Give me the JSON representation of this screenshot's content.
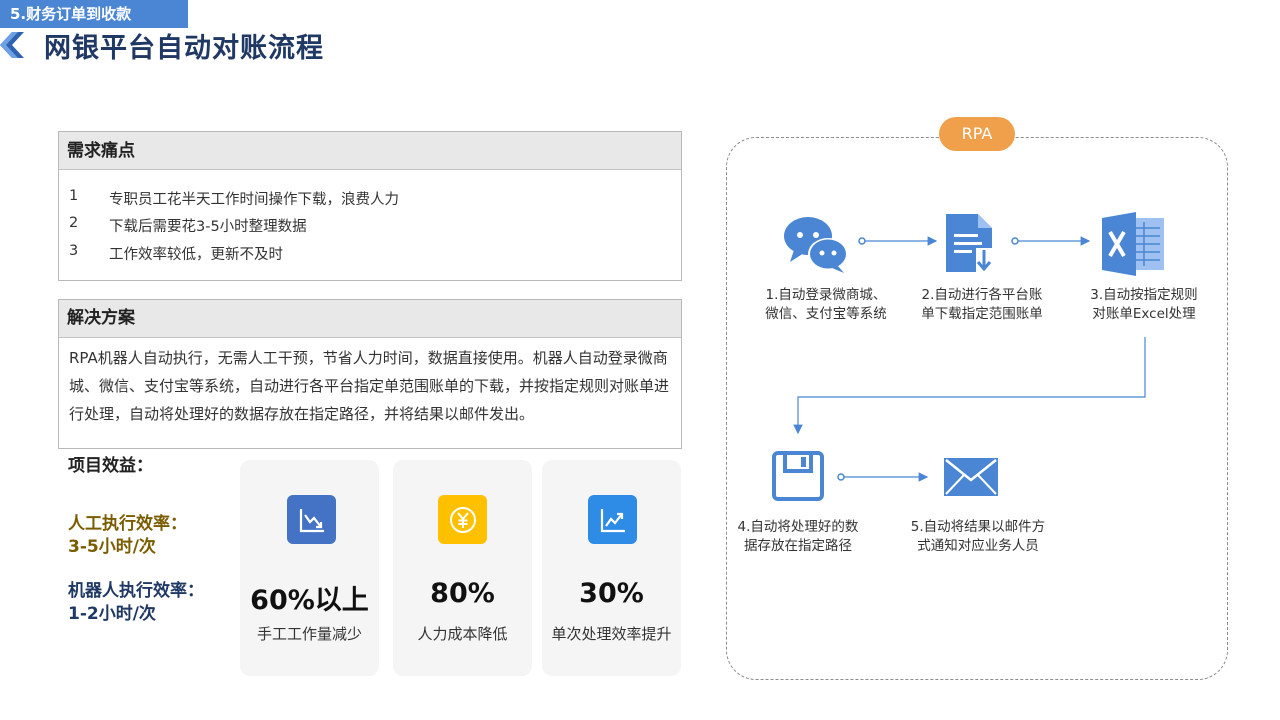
{
  "header": {
    "section_tag": "5.财务订单到收款",
    "title": "网银平台自动对账流程"
  },
  "pain_points": {
    "heading": "需求痛点",
    "items": [
      {
        "num": "1",
        "text": "专职员工花半天工作时间操作下载，浪费人力"
      },
      {
        "num": "2",
        "text": "下载后需要花3-5小时整理数据"
      },
      {
        "num": "3",
        "text": "工作效率较低，更新不及时"
      }
    ]
  },
  "solution": {
    "heading": "解决方案",
    "text": "RPA机器人自动执行，无需人工干预，节省人力时间，数据直接使用。机器人自动登录微商城、微信、支付宝等系统，自动进行各平台指定单范围账单的下载，并按指定规则对账单进行处理，自动将处理好的数据存放在指定路径，并将结果以邮件发出。"
  },
  "benefits": {
    "title": "项目效益：",
    "manual_label": "人工执行效率：",
    "manual_value": "3-5小时/次",
    "robot_label": "机器人执行效率：",
    "robot_value": "1-2小时/次",
    "cards": [
      {
        "value": "60%以上",
        "label": "手工工作量减少",
        "icon": "chart-down-icon",
        "color": "#4472c4"
      },
      {
        "value": "80%",
        "label": "人力成本降低",
        "icon": "yen-coin-icon",
        "color": "#ffc000"
      },
      {
        "value": "30%",
        "label": "单次处理效率提升",
        "icon": "chart-up-icon",
        "color": "#2e8be6"
      }
    ]
  },
  "flow": {
    "badge": "RPA",
    "accent_color": "#4a86d4",
    "steps": [
      {
        "line1": "1.自动登录微商城、",
        "line2": "微信、支付宝等系统",
        "icon": "wechat-icon"
      },
      {
        "line1": "2.自动进行各平台账",
        "line2": "单下载指定范围账单",
        "icon": "document-download-icon"
      },
      {
        "line1": "3.自动按指定规则",
        "line2": "对账单Excel处理",
        "icon": "excel-icon"
      },
      {
        "line1": "4.自动将处理好的数",
        "line2": "据存放在指定路径",
        "icon": "save-icon"
      },
      {
        "line1": "5.自动将结果以邮件方",
        "line2": "式通知对应业务人员",
        "icon": "mail-icon"
      }
    ]
  }
}
